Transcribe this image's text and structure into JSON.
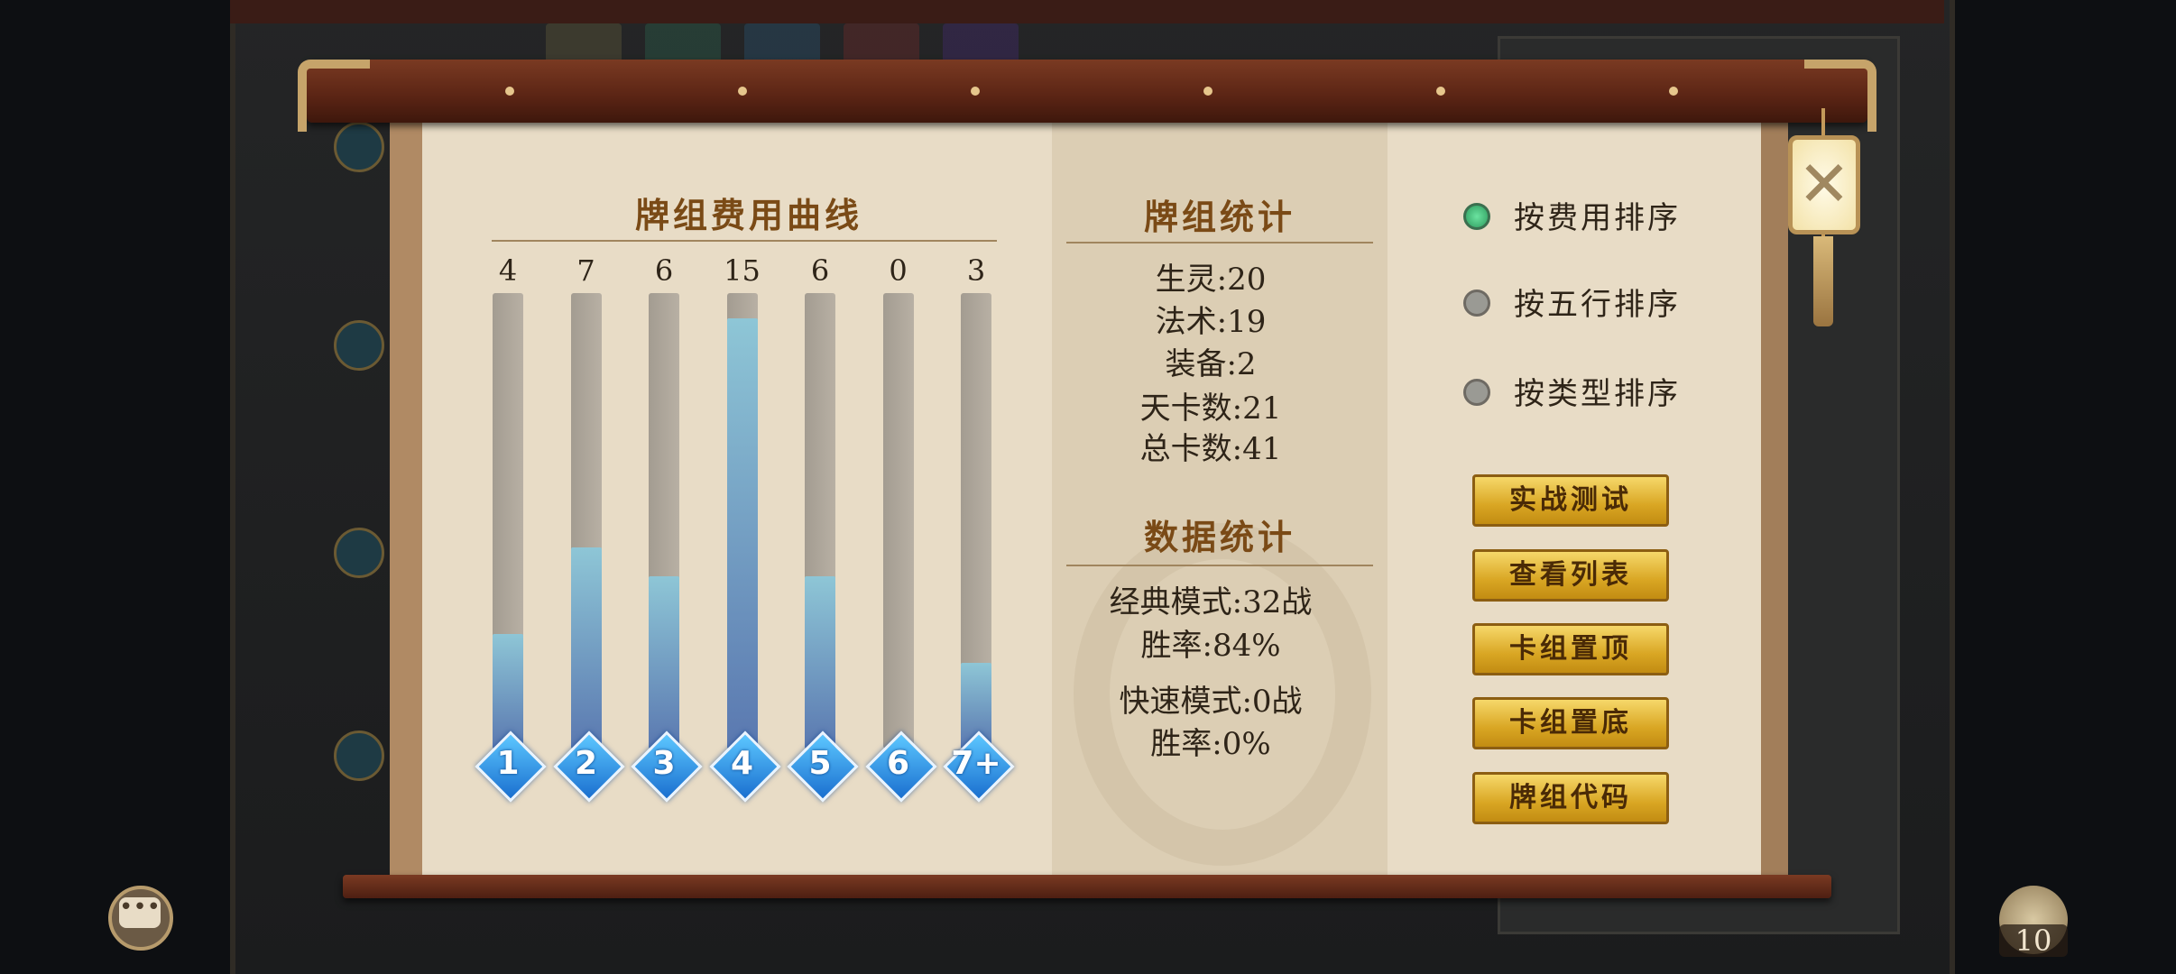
{
  "cost_curve": {
    "title": "牌组费用曲线",
    "max_value": 15,
    "bars": [
      {
        "cost": "1",
        "count": 4
      },
      {
        "cost": "2",
        "count": 7
      },
      {
        "cost": "3",
        "count": 6
      },
      {
        "cost": "4",
        "count": 15
      },
      {
        "cost": "5",
        "count": 6
      },
      {
        "cost": "6",
        "count": 0
      },
      {
        "cost": "7+",
        "count": 3
      }
    ]
  },
  "deck_stats": {
    "title": "牌组统计",
    "lines": [
      "生灵:20",
      "法术:19",
      "装备:2",
      "天卡数:21",
      "总卡数:41"
    ]
  },
  "data_stats": {
    "title": "数据统计",
    "lines": [
      "经典模式:32战",
      "胜率:84%",
      "快速模式:0战",
      "胜率:0%"
    ]
  },
  "sort_options": [
    {
      "label": "按费用排序",
      "selected": true
    },
    {
      "label": "按五行排序",
      "selected": false
    },
    {
      "label": "按类型排序",
      "selected": false
    }
  ],
  "buttons": [
    {
      "name": "battle-test-button",
      "label": "实战测试"
    },
    {
      "name": "view-list-button",
      "label": "查看列表"
    },
    {
      "name": "deck-to-top-button",
      "label": "卡组置顶"
    },
    {
      "name": "deck-to-bottom-button",
      "label": "卡组置底"
    },
    {
      "name": "deck-code-button",
      "label": "牌组代码"
    }
  ],
  "close_icon": "✕",
  "chat_icon": "•••",
  "currency_count": "10",
  "colors": {
    "bar_fill": "#6ea6cc",
    "gold_button": "#e8bd3a",
    "radio_selected": "#3fbf78",
    "heading": "#7a4a16"
  }
}
